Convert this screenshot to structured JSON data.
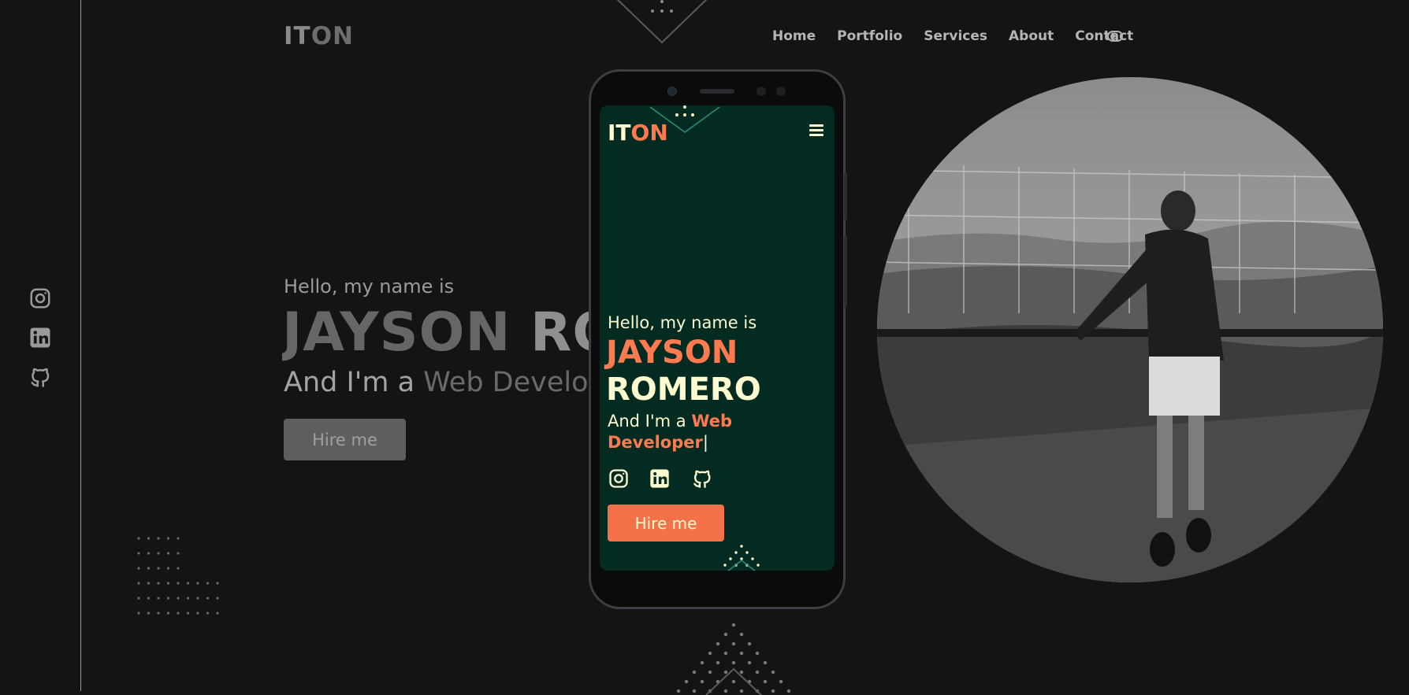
{
  "brand": {
    "logo_part1": "IT",
    "logo_part2": "ON"
  },
  "nav": {
    "items": [
      "Home",
      "Portfolio",
      "Services",
      "About",
      "Contact"
    ],
    "theme_toggle_icon": "toggle-icon"
  },
  "social": {
    "icons": [
      "instagram-icon",
      "linkedin-icon",
      "github-icon"
    ]
  },
  "hero": {
    "greeting": "Hello, my name is",
    "first_name": "JAYSON",
    "last_name": "ROMERO",
    "role_prefix": "And I'm a",
    "role_highlight": "Web Developer",
    "hire_label": "Hire me"
  },
  "mobile_preview": {
    "logo_part1": "IT",
    "logo_part2": "ON",
    "menu_icon": "hamburger-icon",
    "greeting": "Hello, my name is",
    "first_name": "JAYSON",
    "last_name": "ROMERO",
    "role_prefix": "And I'm a",
    "role_highlight_1": "Web",
    "role_highlight_2": "Developer",
    "cursor": "|",
    "hire_label": "Hire me"
  },
  "colors": {
    "page_bg": "#141414",
    "mobile_bg": "#032b22",
    "accent": "#ff7a4f",
    "mobile_text": "#fffbd0"
  }
}
